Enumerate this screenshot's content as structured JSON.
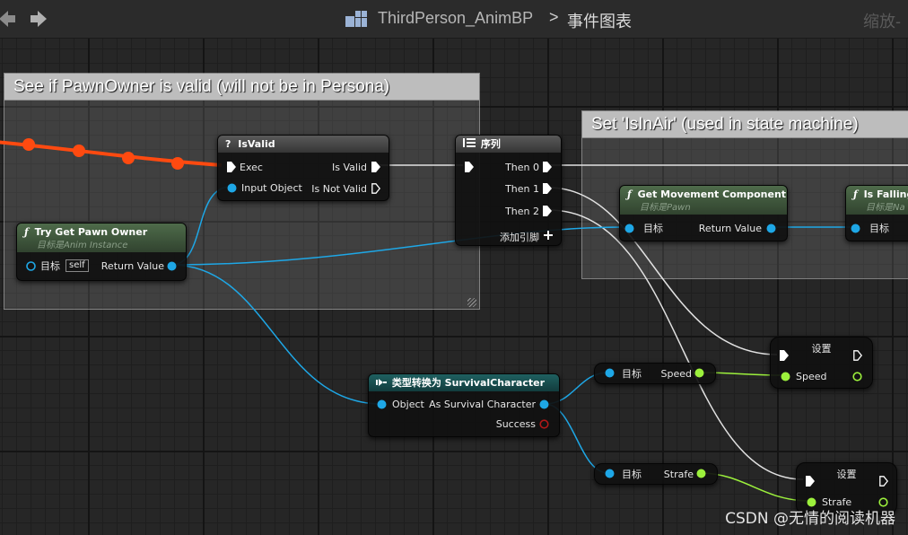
{
  "toolbar": {
    "back_icon": "arrow-left-icon",
    "forward_icon": "arrow-right-icon",
    "breadcrumb_icon": "blueprint-grid-icon",
    "breadcrumb_asset": "ThirdPerson_AnimBP",
    "breadcrumb_sep": ">",
    "breadcrumb_graph": "事件图表",
    "zoom_text": "缩放-"
  },
  "comments": {
    "pawn_owner": "See if PawnOwner is valid (will not be in Persona)",
    "in_air": "Set 'IsInAir' (used in state machine)"
  },
  "nodes": {
    "is_valid": {
      "icon": "?",
      "title": "IsValid",
      "exec_label": "Exec",
      "input_object": "Input Object",
      "out_valid": "Is Valid",
      "out_not_valid": "Is Not Valid"
    },
    "sequence": {
      "title": "序列",
      "then0": "Then 0",
      "then1": "Then 1",
      "then2": "Then 2",
      "add_pin": "添加引脚"
    },
    "try_get_pawn": {
      "title": "Try Get Pawn Owner",
      "subtitle": "目标是Anim Instance",
      "target": "目标",
      "self": "self",
      "return_value": "Return Value"
    },
    "get_movement": {
      "title": "Get Movement Component",
      "subtitle": "目标是Pawn",
      "target": "目标",
      "return_value": "Return Value"
    },
    "is_falling": {
      "title": "Is Falling",
      "subtitle": "目标是Na",
      "target": "目标"
    },
    "cast": {
      "title": "类型转换为 SurvivalCharacter",
      "object": "Object",
      "as_survival": "As Survival Character",
      "success": "Success"
    },
    "get_speed": {
      "target": "目标",
      "label": "Speed"
    },
    "get_strafe": {
      "target": "目标",
      "label": "Strafe"
    },
    "set_speed": {
      "title": "设置",
      "label": "Speed"
    },
    "set_strafe": {
      "title": "设置",
      "label": "Strafe"
    }
  },
  "colors": {
    "exec_wire": "#e6e6e6",
    "object_pin": "#1ea7e6",
    "float_pin": "#9cf03c",
    "bool_pin": "#8e1010",
    "active_exec": "#ff4a10"
  },
  "watermark": "CSDN @无情的阅读机器"
}
